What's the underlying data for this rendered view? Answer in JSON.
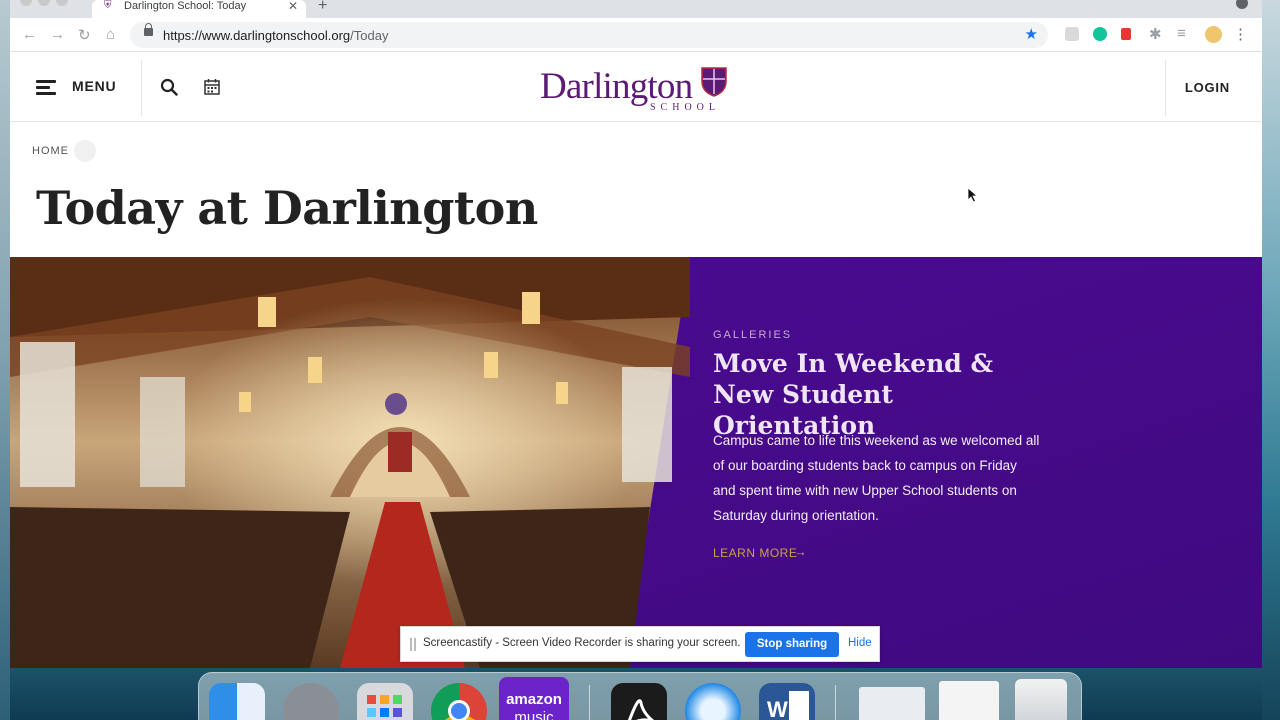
{
  "browser": {
    "tab_title": "Darlington School: Today",
    "url_host": "https://www.darlingtonschool.org",
    "url_path": "/Today",
    "new_tab_symbol": "+",
    "close_symbol": "✕"
  },
  "site": {
    "menu_label": "MENU",
    "logo_text": "Darlington",
    "logo_subtext": "SCHOOL",
    "login_label": "LOGIN",
    "brand_purple": "#4b0a91"
  },
  "page": {
    "breadcrumb": "HOME",
    "title": "Today at Darlington"
  },
  "feature": {
    "kicker": "GALLERIES",
    "title": "Move In Weekend & New Student Orientation",
    "body": "Campus came to life this weekend as we welcomed all of our boarding students back to campus on Friday and spent time with new Upper School students on Saturday during orientation.",
    "learn_more": "LEARN MORE",
    "arrow": "→"
  },
  "screencastify": {
    "message": "Screencastify - Screen Video Recorder is sharing your screen.",
    "stop_label": "Stop sharing",
    "hide_label": "Hide"
  },
  "dock": {
    "amazon_label_1": "amazon",
    "amazon_label_2": "music",
    "apps": [
      "finder-icon",
      "system-preferences-icon",
      "launchpad-icon",
      "chrome-icon",
      "amazon-music-icon",
      "acrobat-icon",
      "safari-icon",
      "word-icon",
      "preview-window-icon",
      "document-window-icon",
      "trash-icon"
    ]
  }
}
